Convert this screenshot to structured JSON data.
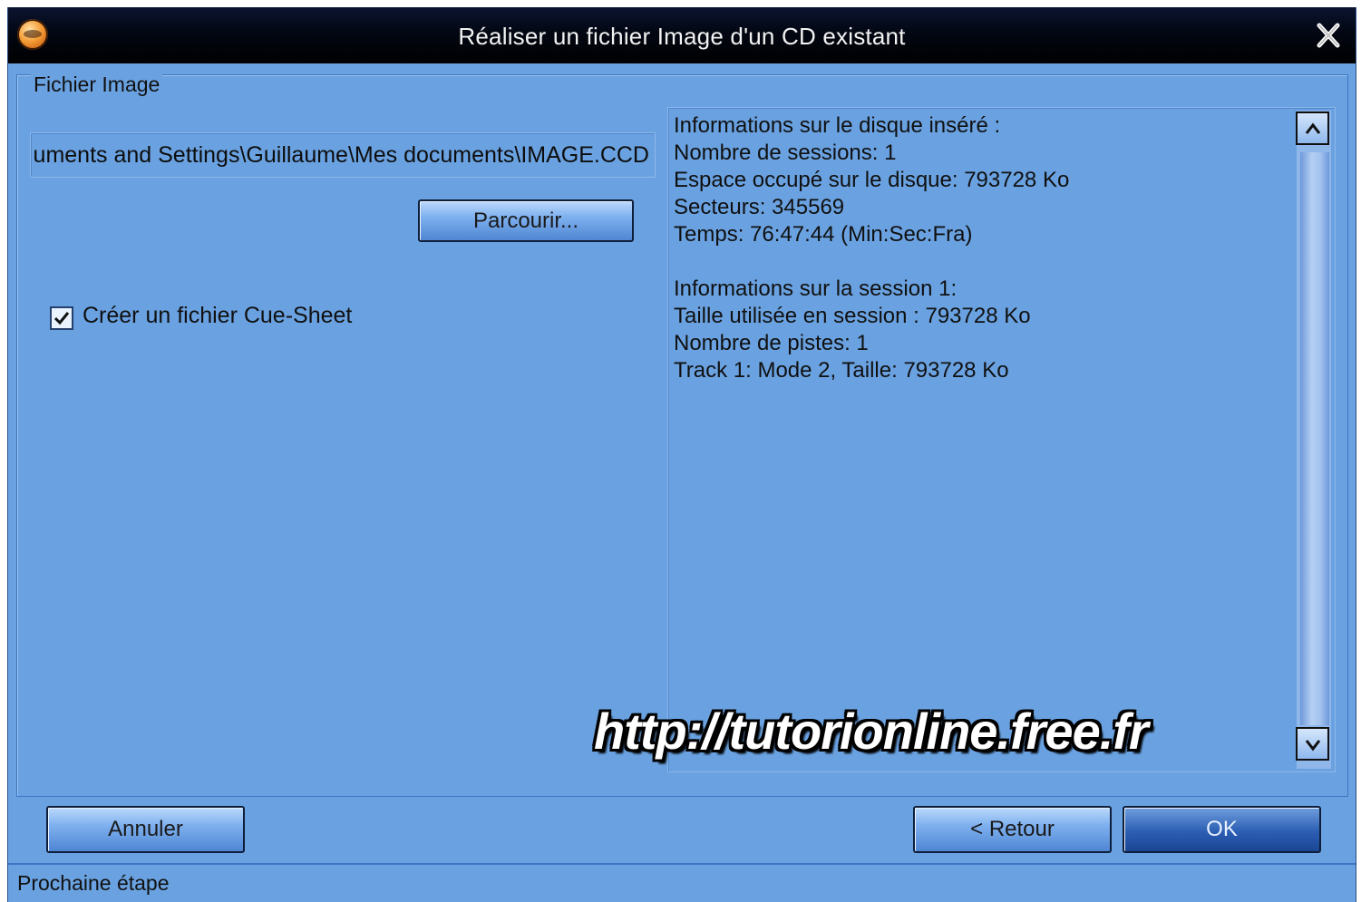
{
  "window": {
    "title": "Réaliser un fichier Image d'un CD existant"
  },
  "icons": {
    "app": "app-logo-icon",
    "close": "close-icon",
    "check": "checkmark-icon",
    "scroll_up": "arrow-up-icon",
    "scroll_down": "arrow-down-icon"
  },
  "image_group": {
    "legend": "Fichier Image",
    "path_value": "uments and Settings\\Guillaume\\Mes documents\\IMAGE.CCD",
    "browse_label": "Parcourir...",
    "cue_sheet_label": "Créer un fichier Cue-Sheet",
    "cue_sheet_checked": true
  },
  "info": {
    "disc_lines": [
      "Informations sur le disque inséré :",
      "Nombre de sessions: 1",
      "Espace occupé sur le disque: 793728 Ko",
      "Secteurs: 345569",
      "Temps: 76:47:44 (Min:Sec:Fra)"
    ],
    "session_lines": [
      "Informations sur la session 1:",
      "Taille utilisée en session : 793728 Ko",
      "Nombre de pistes: 1",
      "Track 1: Mode 2, Taille: 793728 Ko"
    ]
  },
  "watermark": "http://tutorionline.free.fr",
  "buttons": {
    "cancel": "Annuler",
    "back": "< Retour",
    "ok": "OK"
  },
  "status": "Prochaine étape",
  "colors": {
    "window_bg": "#6aa2e1",
    "titlebar_bg": "#000000",
    "ok_button": "#2c5eb3"
  }
}
